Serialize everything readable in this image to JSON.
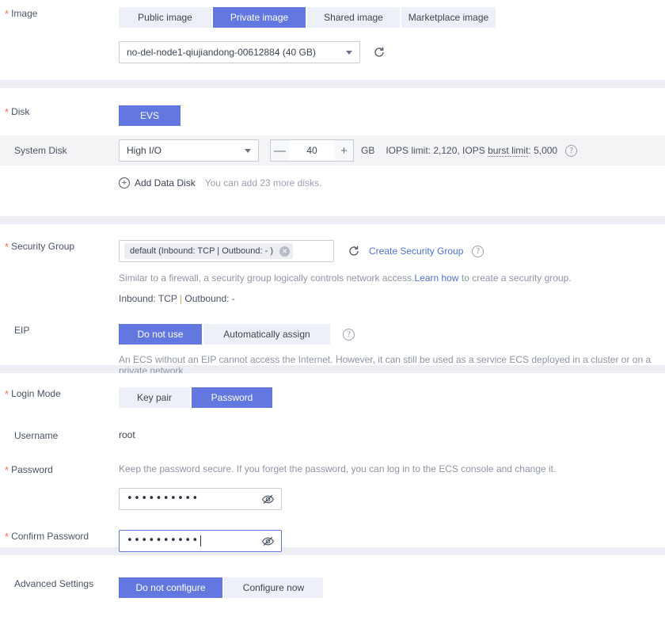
{
  "image": {
    "label": "Image",
    "required": true,
    "tabs": [
      {
        "label": "Public image",
        "active": false
      },
      {
        "label": "Private image",
        "active": true
      },
      {
        "label": "Shared image",
        "active": false
      },
      {
        "label": "Marketplace image",
        "active": false
      }
    ],
    "selected_image": "no-del-node1-qiujiandong-00612884 (40 GB)",
    "refresh_icon": "refresh-icon"
  },
  "disk": {
    "label": "Disk",
    "required": true,
    "tabs": [
      {
        "label": "EVS",
        "active": true
      }
    ],
    "system_disk": {
      "label": "System Disk",
      "type": "High I/O",
      "size": "40",
      "unit": "GB",
      "iops_prefix": "IOPS limit: 2,120, IOPS ",
      "iops_dotted": "burst limit",
      "iops_suffix": ": 5,000",
      "decrement": "—",
      "increment": "+",
      "help_icon": "help-icon"
    },
    "add_data_disk": "Add Data Disk",
    "add_data_disk_hint": "You can add 23 more disks."
  },
  "security_group": {
    "label": "Security Group",
    "required": true,
    "tag": "default (Inbound: TCP | Outbound: - )",
    "tag_remove_icon": "close-icon",
    "refresh_icon": "refresh-icon",
    "create_link": "Create Security Group",
    "help_icon": "help-icon",
    "description_before": "Similar to a firewall, a security group logically controls network access.",
    "description_link": "Learn how",
    "description_after": " to create a security group.",
    "summary_inbound": "Inbound: TCP ",
    "summary_separator": "|",
    "summary_outbound": " Outbound: -"
  },
  "eip": {
    "label": "EIP",
    "required": false,
    "tabs": [
      {
        "label": "Do not use",
        "active": true
      },
      {
        "label": "Automatically assign",
        "active": false
      }
    ],
    "help_icon": "help-icon",
    "description": "An ECS without an EIP cannot access the Internet. However, it can still be used as a service ECS deployed in a cluster or on a private network."
  },
  "login": {
    "mode_label": "Login Mode",
    "mode_required": true,
    "tabs": [
      {
        "label": "Key pair",
        "active": false
      },
      {
        "label": "Password",
        "active": true
      }
    ],
    "username_label": "Username",
    "username_value": "root",
    "password_label": "Password",
    "password_required": true,
    "password_hint": "Keep the password secure. If you forget the password, you can log in to the ECS console and change it.",
    "password_value": "••••••••••",
    "password_eye_icon": "eye-off-icon",
    "confirm_label": "Confirm Password",
    "confirm_required": true,
    "confirm_value": "••••••••••",
    "confirm_eye_icon": "eye-off-icon"
  },
  "advanced": {
    "label": "Advanced Settings",
    "required": false,
    "tabs": [
      {
        "label": "Do not configure",
        "active": true
      },
      {
        "label": "Configure now",
        "active": false
      }
    ]
  },
  "colors": {
    "accent": "#6277e0",
    "tab_inactive_bg": "#eef0f8",
    "divider": "#eceef4",
    "link": "#4f70d6",
    "required_star": "#e8705a",
    "band": "#f4f4f7"
  }
}
